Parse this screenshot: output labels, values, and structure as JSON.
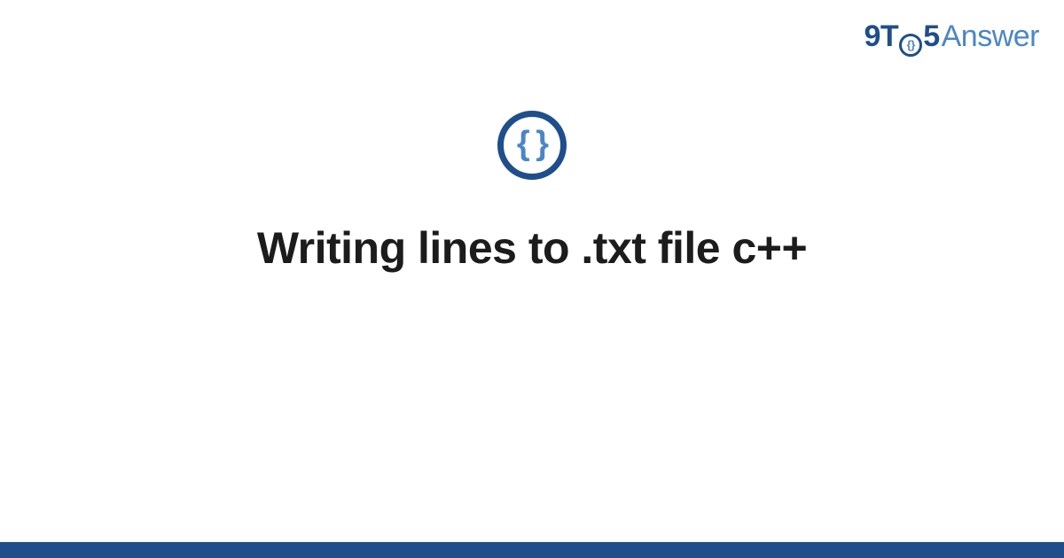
{
  "brand": {
    "part1": "9T",
    "circle_inner": "{}",
    "part2": "5",
    "part3": "Answer"
  },
  "icon": {
    "symbol": "{ }"
  },
  "title": "Writing lines to .txt file c++",
  "colors": {
    "primary": "#1f4e8c",
    "accent": "#4a86c7",
    "text": "#1c1c1c"
  }
}
